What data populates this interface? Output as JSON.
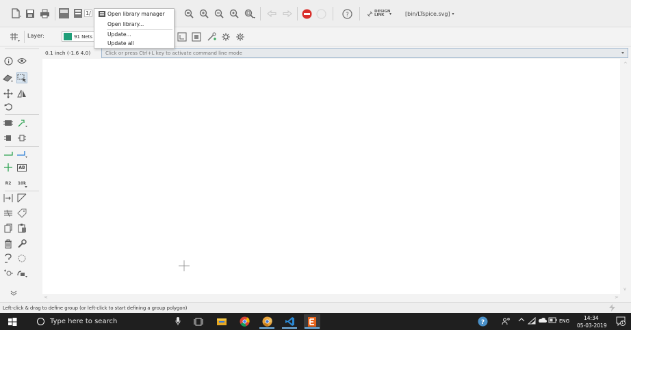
{
  "toolbar": {
    "design_link_text": "DESIGN LINK",
    "file_path": "[bin/LTspice.svg]",
    "library_badge": "1/",
    "group_icon_text": "GRP"
  },
  "dropdown_menu": {
    "items": [
      {
        "label": "Open library manager"
      },
      {
        "label": "Open library..."
      },
      {
        "label": "Update..."
      },
      {
        "label": "Update all"
      }
    ]
  },
  "layer_bar": {
    "label": "Layer:",
    "selected_layer": "91 Nets",
    "layer_color": "#1e9e78"
  },
  "command": {
    "grid_readout": "0.1 inch (-1.6 4.0)",
    "placeholder": "Click or press Ctrl+L key to activate command line mode"
  },
  "palette_labels": {
    "ab_label": "AB",
    "name_label": "R2",
    "value_label": "10k"
  },
  "status": {
    "message": "Left-click & drag to define group (or left-click to start defining a group polygon)"
  },
  "taskbar": {
    "search_placeholder": "Type here to search",
    "language": "ENG",
    "time": "14:34",
    "date": "05-03-2019",
    "notification_count": "1"
  },
  "colors": {
    "accent": "#76b9ed",
    "taskbar_bg": "#1f1f1f",
    "stop_red": "#d9302c"
  }
}
